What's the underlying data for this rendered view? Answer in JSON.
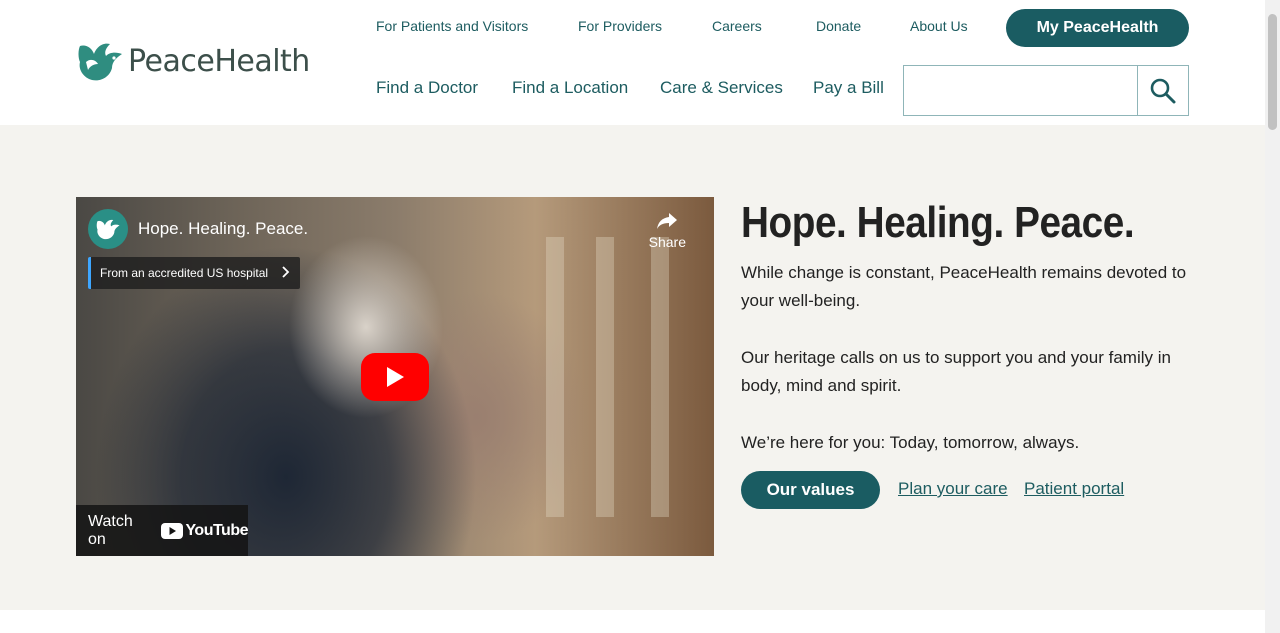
{
  "brand": {
    "name": "PeaceHealth",
    "primary_color": "#1a5c62"
  },
  "utility_nav": [
    {
      "label": "For Patients and Visitors"
    },
    {
      "label": "For Providers"
    },
    {
      "label": "Careers"
    },
    {
      "label": "Donate"
    },
    {
      "label": "About Us"
    }
  ],
  "my_peacehealth_label": "My PeaceHealth",
  "main_nav": [
    {
      "label": "Find a Doctor"
    },
    {
      "label": "Find a Location"
    },
    {
      "label": "Care & Services"
    },
    {
      "label": "Pay a Bill"
    }
  ],
  "search": {
    "placeholder": "",
    "icon": "search-icon"
  },
  "video": {
    "title": "Hope. Healing. Peace.",
    "share_label": "Share",
    "accredited_label": "From an accredited US hospital",
    "watch_on_label": "Watch on",
    "youtube_label": "YouTube"
  },
  "hero": {
    "title": "Hope. Healing. Peace.",
    "paragraphs": [
      "While change is constant, PeaceHealth remains devoted to your well-being.",
      "Our heritage calls on us to support you and your family in body, mind and spirit.",
      "We’re here for you: Today, tomorrow, always."
    ],
    "cta_button": "Our values",
    "links": [
      "Plan your care",
      "Patient portal"
    ]
  }
}
